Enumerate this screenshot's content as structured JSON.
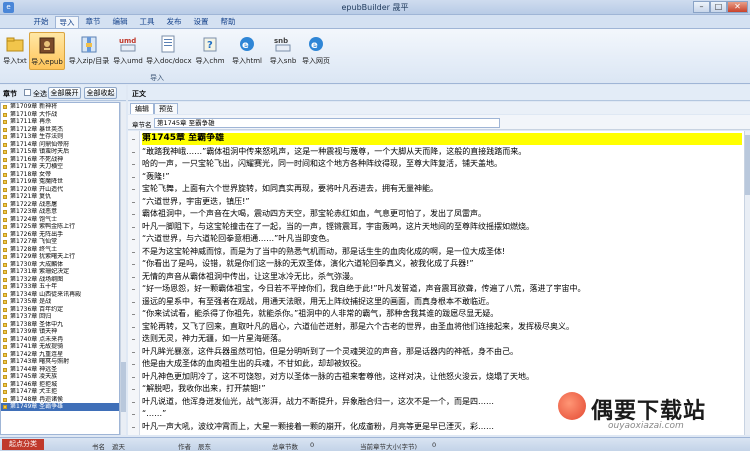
{
  "window": {
    "title": "epubBuilder 晟平",
    "min": "–",
    "max": "□",
    "close": "✕"
  },
  "menu": [
    {
      "label": "开始"
    },
    {
      "label": "导入"
    },
    {
      "label": "章节"
    },
    {
      "label": "编辑"
    },
    {
      "label": "工具"
    },
    {
      "label": "发布"
    },
    {
      "label": "设置"
    },
    {
      "label": "帮助"
    }
  ],
  "ribbon": {
    "buttons": [
      {
        "label": "导入txt",
        "icon": "folder-icon"
      },
      {
        "label": "导入epub",
        "icon": "book-icon"
      },
      {
        "label": "导入zip/目录",
        "icon": "archive-icon"
      },
      {
        "label": "导入umd",
        "icon": "umd-icon"
      },
      {
        "label": "导入doc/docx",
        "icon": "doc-icon"
      },
      {
        "label": "导入chm",
        "icon": "chm-icon"
      },
      {
        "label": "导入html",
        "icon": "ie-icon"
      },
      {
        "label": "导入snb",
        "icon": "snb-icon"
      },
      {
        "label": "导入网页",
        "icon": "web-icon"
      }
    ],
    "group_label": "导入"
  },
  "left": {
    "header": "章节",
    "check_all": "全选",
    "expand_all": "全部展开",
    "collapse_all": "全部收起",
    "chapters": [
      "第1709章 新神将",
      "第1710章 大作战",
      "第1711章 再杀",
      "第1712章 暴世英杰",
      "第1713章 生存法则",
      "第1714章 问鼎仙帝府",
      "第1715章 镇蛮时天后",
      "第1716章 不死战神",
      "第1717章 天刀横空",
      "第1718章 女帝",
      "第1719章 冤魔降世",
      "第1720章 开山造代",
      "第1721章 复仇",
      "第1722章 战恶屠",
      "第1723章 战恶意",
      "第1724章 饱气士",
      "第1725章 紫鸭金陈上行",
      "第1726章 无阵出手",
      "第1727章 飞仙堂",
      "第1728章 终气土",
      "第1729章 犹紫曙天上行",
      "第1730章 大成麟体",
      "第1731章 紫珊妃决定",
      "第1732章 战场纲图",
      "第1733章 五十年",
      "第1734章 山西徒来讯再殿",
      "第1735章 是战",
      "第1736章 百年约定",
      "第1737章 回归",
      "第1738章 圣体中九",
      "第1739章 镇天神",
      "第1740章 点未来冉",
      "第1741章 无故提骑",
      "第1742章 九重连星",
      "第1743章 曙冥与照射",
      "第1744章 神远圣",
      "第1745章 凌天族",
      "第1746章 拒拒城",
      "第1747章 犬王拒",
      "第1748章 冉迩诸侯",
      "第1749章 圣霸争雄"
    ]
  },
  "right": {
    "header": "正文",
    "tab_edit": "编辑",
    "tab_preview": "预览",
    "name_label": "章节名",
    "chapter_name": "第1745章 至霸争雄",
    "lines": [
      "第1745章 至霸争雄",
      "“敢踏我神峨……”霸体祖洞中传来怒吼声，这是一种震视与蔑尊，一个大脚从天而降，这般的直接践踏而来。",
      "哈的一声，一只宝轮飞出，闪耀赛光，同一时间和这个地方各种阵纹得现，至尊大阵复活，铺天盖地。",
      "“轰隆!”",
      "宝轮飞舞，上面有六个世界旋转，如同真实再现，要将叶凡吞进去，拥有无量神能。",
      "“六道世界，宇宙更迭，镇压!”",
      "霸体祖洞中，一个声音在大喝，震动四方天空，那宝轮赤红如血，气息更可怕了，发出了凤雷声。",
      "叶凡一脚阻下，与这宝轮撞击在了一起，当的一声，铿锵震耳，宇宙轰鸣，这片天地间的至尊阵纹摇摆如燃烧。",
      "“六道世界，与六道轮回拳意相通……”叶凡当即变色。",
      "不是为这宝轮神威而惊，而是为了当中的熟悉气机而动，那是话生生的血肉化成的啊，是一位大成圣体!",
      "“你看出了是吗，设错，就是你们这一脉的无双圣体，演化六道轮回拳真义，被我化成了兵器!”",
      "无情的声音从霸体祖洞中传出，让这里冰冷无比，杀气弥漫。",
      "“好一场恩怨，好一颗霸体祖宝，今日若不平掉你们，我自绝于此!”叶凡发誓道，声音震耳欲聋，传遍了八荒，落进了宇宙中。",
      "遥远的星系中，有至强者在观战，用通天法眼，用无上阵纹捕捉这里的画面，而真身根本不敢临近。",
      "“你来试试看，能杀得了你祖先，就能杀你。”祖洞中的人非常的霸气，那种舍我其谁的跋扈尽显无疑。",
      "宝轮再转，又飞了回来，直取叶凡的眉心，六道仙芒迸射，那是六个古老的世界，由圣血将他们连接起来，发挥极尽奥义。",
      "迭则无灵，神力无疆，如一片星海砸落。",
      "叶凡眸光暴涨，这件兵器虽然可怕，但是分明听到了一个灵魂哭泣的声音，那是话器内的神祇，身不由己。",
      "他是由大成圣体的血肉祖生出的兵魂，不甘如此，却却被奴役。",
      "叶凡神色更加阴冷了，这不可饶恕，对方以圣体一脉的古祖来奢尊他，这样对决，让他怒火浚云，烧塌了天地。",
      "“解脱吧，我收你出来，打开禁锢!”",
      "叶凡说道，他浑身迸发仙光，战气澎湃，战力不断提升，异象融合归一，这次不是一个，而是四……",
      "“……”",
      "叶凡一声大吼，波纹冲霄而上，大星一颗接着一颗的崩开，化成齑粉，月亮等更是早已湮灭，彩……"
    ]
  },
  "status": {
    "tag": "起点分类",
    "book_label": "书名",
    "book_value": "遮天",
    "author_label": "作者",
    "author_value": "辰东",
    "total_label": "总章节数",
    "total_value": "0",
    "current_label": "当前章节大小(字节)",
    "current_value": "0"
  },
  "watermark": {
    "text": "偶要下载站",
    "url": "ouyaoxiazai.com"
  },
  "colors": {
    "accent": "#15428b",
    "highlight": "#ffff00",
    "selected": "#3f6fb8"
  }
}
